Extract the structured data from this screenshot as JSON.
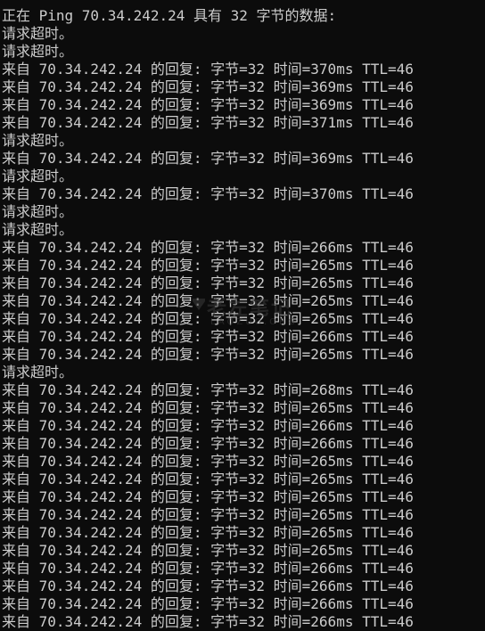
{
  "console": {
    "lines": [
      "正在 Ping 70.34.242.24 具有 32 字节的数据:",
      "请求超时。",
      "请求超时。",
      "来自 70.34.242.24 的回复: 字节=32 时间=370ms TTL=46",
      "来自 70.34.242.24 的回复: 字节=32 时间=369ms TTL=46",
      "来自 70.34.242.24 的回复: 字节=32 时间=369ms TTL=46",
      "来自 70.34.242.24 的回复: 字节=32 时间=371ms TTL=46",
      "请求超时。",
      "来自 70.34.242.24 的回复: 字节=32 时间=369ms TTL=46",
      "请求超时。",
      "来自 70.34.242.24 的回复: 字节=32 时间=370ms TTL=46",
      "请求超时。",
      "请求超时。",
      "来自 70.34.242.24 的回复: 字节=32 时间=266ms TTL=46",
      "来自 70.34.242.24 的回复: 字节=32 时间=265ms TTL=46",
      "来自 70.34.242.24 的回复: 字节=32 时间=265ms TTL=46",
      "来自 70.34.242.24 的回复: 字节=32 时间=265ms TTL=46",
      "来自 70.34.242.24 的回复: 字节=32 时间=265ms TTL=46",
      "来自 70.34.242.24 的回复: 字节=32 时间=266ms TTL=46",
      "来自 70.34.242.24 的回复: 字节=32 时间=265ms TTL=46",
      "请求超时。",
      "来自 70.34.242.24 的回复: 字节=32 时间=268ms TTL=46",
      "来自 70.34.242.24 的回复: 字节=32 时间=265ms TTL=46",
      "来自 70.34.242.24 的回复: 字节=32 时间=266ms TTL=46",
      "来自 70.34.242.24 的回复: 字节=32 时间=266ms TTL=46",
      "来自 70.34.242.24 的回复: 字节=32 时间=265ms TTL=46",
      "来自 70.34.242.24 的回复: 字节=32 时间=265ms TTL=46",
      "来自 70.34.242.24 的回复: 字节=32 时间=265ms TTL=46",
      "来自 70.34.242.24 的回复: 字节=32 时间=265ms TTL=46",
      "来自 70.34.242.24 的回复: 字节=32 时间=265ms TTL=46",
      "来自 70.34.242.24 的回复: 字节=32 时间=265ms TTL=46",
      "来自 70.34.242.24 的回复: 字节=32 时间=266ms TTL=46",
      "来自 70.34.242.24 的回复: 字节=32 时间=266ms TTL=46",
      "来自 70.34.242.24 的回复: 字节=32 时间=266ms TTL=46",
      "来自 70.34.242.24 的回复: 字节=32 时间=266ms TTL=46"
    ]
  },
  "watermark": {
    "main": "老左笔记",
    "sub": "LAOZUO.ORG"
  },
  "colors": {
    "background": "#0c0c0c",
    "text": "#cccccc"
  }
}
